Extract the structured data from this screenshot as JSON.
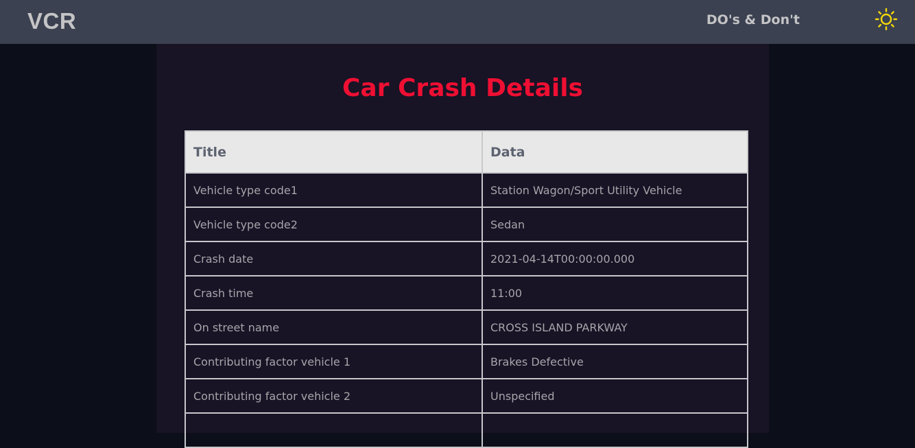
{
  "navbar": {
    "brand": "VCR",
    "link_label": "DO's & Don't",
    "theme_icon": "sun-icon",
    "theme_icon_color": "#f5d90a"
  },
  "page": {
    "title": "Car Crash Details",
    "title_color": "#ee0f33"
  },
  "table": {
    "headers": [
      "Title",
      "Data"
    ],
    "rows": [
      [
        "Vehicle type code1",
        "Station Wagon/Sport Utility Vehicle"
      ],
      [
        "Vehicle type code2",
        "Sedan"
      ],
      [
        "Crash date",
        "2021-04-14T00:00:00.000"
      ],
      [
        "Crash time",
        "11:00"
      ],
      [
        "On street name",
        "CROSS ISLAND PARKWAY"
      ],
      [
        "Contributing factor vehicle 1",
        "Brakes Defective"
      ],
      [
        "Contributing factor vehicle 2",
        "Unspecified"
      ],
      [
        "",
        ""
      ]
    ]
  }
}
